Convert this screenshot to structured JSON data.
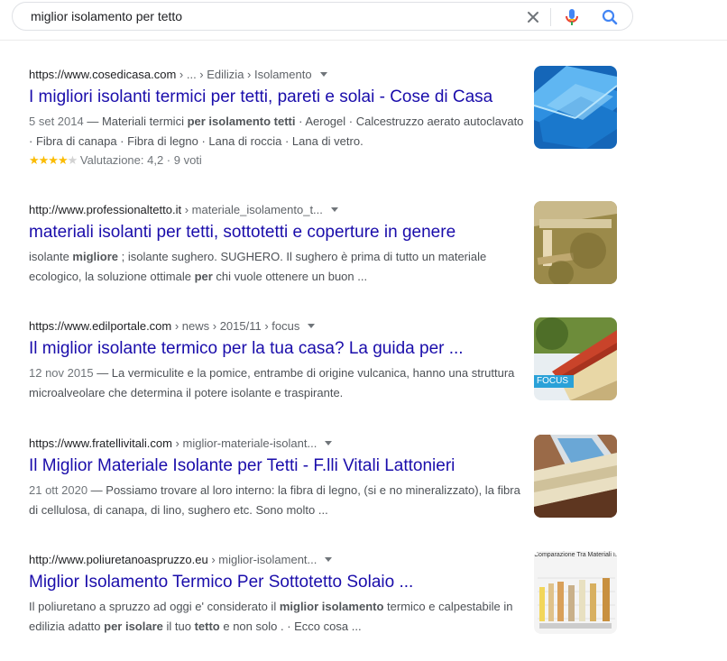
{
  "search": {
    "query": "miglior isolamento per tetto",
    "clear_icon": "close-icon",
    "mic_icon": "microphone-icon",
    "search_icon": "search-icon"
  },
  "colors": {
    "link": "#1a0dab",
    "snippet": "#4d5156",
    "star": "#fbbc04",
    "focus_badge": "#2aa1d8"
  },
  "results": [
    {
      "site": "https://www.cosedicasa.com",
      "path": " › ... › Edilizia › Isolamento",
      "title": "I migliori isolanti termici per tetti, pareti e solai - Cose di Casa",
      "date": "5 set 2014",
      "snippet": [
        " — Materiali termici ",
        "per isolamento tetti",
        " · Aerogel · Calcestruzzo aerato autoclavato · Fibra di canapa · Fibra di legno · Lana di roccia · Lana di vetro."
      ],
      "rating_text": "Valutazione: 4,2 · 9 voti",
      "rating_value": 4.2,
      "thumb": "blue-insulation-panels"
    },
    {
      "site": "http://www.professionaltetto.it",
      "path": " › materiale_isolamento_t...",
      "title": "materiali isolanti per tetti, sottotetti e coperture in genere",
      "snippet": [
        "isolante ",
        "migliore",
        " ; isolante sughero. SUGHERO. Il sughero è prima di tutto un materiale ecologico, la soluzione ottimale ",
        "per",
        " chi vuole ottenere un buon ..."
      ],
      "thumb": "cork-insulation-roof"
    },
    {
      "site": "https://www.edilportale.com",
      "path": " › news › 2015/11 › focus",
      "title": "Il miglior isolante termico per la tua casa? La guida per ...",
      "date": "12 nov 2015",
      "snippet": [
        " — La vermiculite e la pomice, entrambe di origine vulcanica, hanno una struttura microalveolare che determina il potere isolante e traspirante."
      ],
      "badge": "FOCUS",
      "thumb": "roof-section-tiles"
    },
    {
      "site": "https://www.fratellivitali.com",
      "path": " › miglior-materiale-isolant...",
      "title": "Il Miglior Materiale Isolante per Tetti - F.lli Vitali Lattonieri",
      "date": "21 ott 2020",
      "snippet": [
        " — Possiamo trovare al loro interno: la fibra di legno, (si e no mineralizzato), la fibra di cellulosa, di canapa, di lino, sughero etc. Sono molto ..."
      ],
      "thumb": "skylight-insulation"
    },
    {
      "site": "http://www.poliuretanoaspruzzo.eu",
      "path": " › miglior-isolament...",
      "title": "Miglior Isolamento Termico Per Sottotetto Solaio ...",
      "snippet": [
        "Il poliuretano a spruzzo ad oggi e' considerato il ",
        "miglior isolamento",
        " termico e calpestabile in edilizia adatto ",
        "per isolare",
        " il tuo ",
        "tetto",
        " e non solo . · Ecco cosa ..."
      ],
      "thumb_caption": "Comparazione Tra Materiali Isola",
      "thumb": "insulation-comparison-chart"
    }
  ]
}
